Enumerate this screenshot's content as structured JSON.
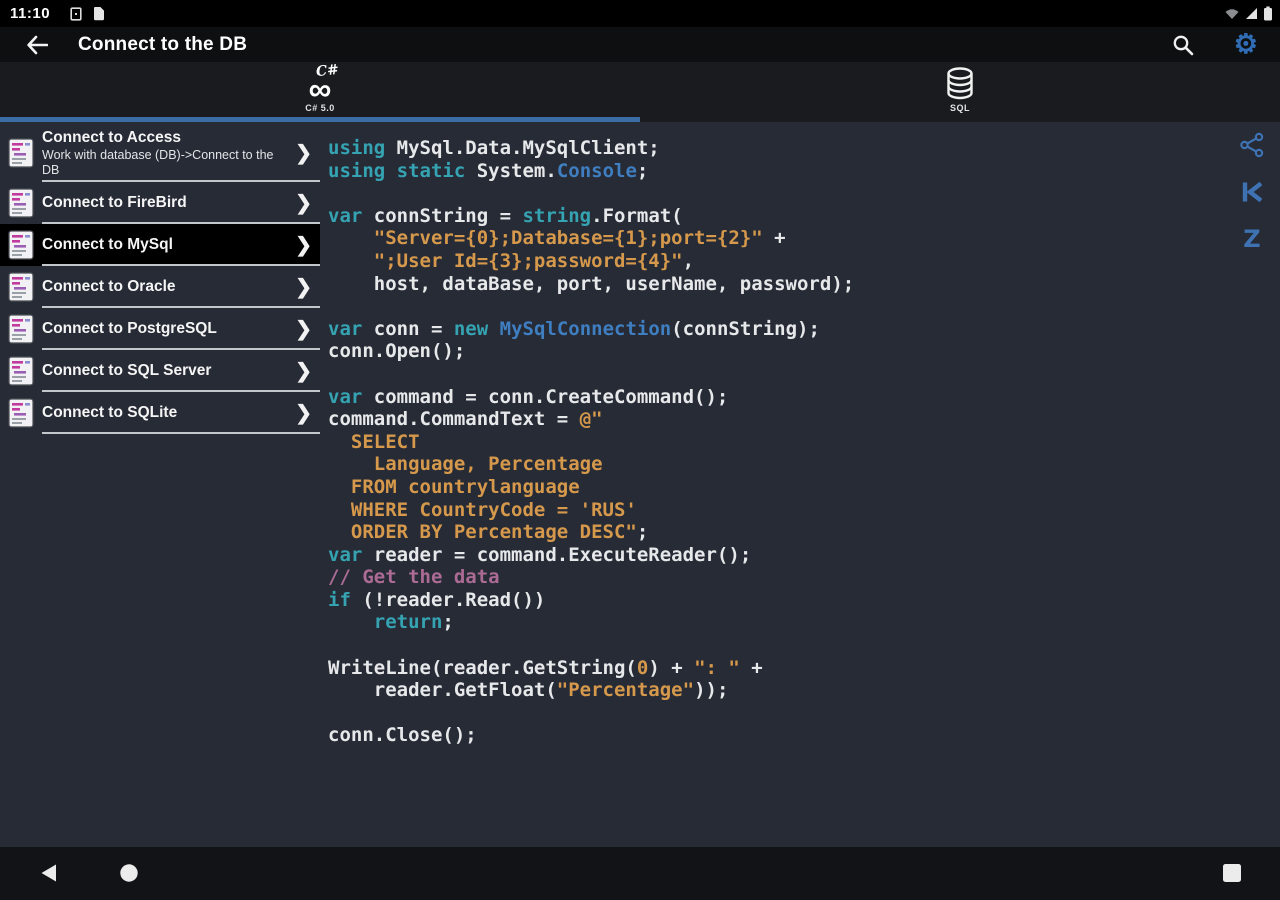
{
  "colors": {
    "bg-content": "#262b36",
    "bg-status": "#000000",
    "bg-appbar": "#0e0f11",
    "bg-tabbar": "#191b1e",
    "bg-navbar": "#121316",
    "accent": "#3b6ca3",
    "icon-blue": "#3e72b2",
    "gear-blue": "#2f6cb3",
    "divider": "#c3c6ca",
    "selected-bg": "#000000",
    "tok-kw": "#35a3b2",
    "tok-cls": "#3f7ec0",
    "tok-str": "#d6994c",
    "tok-com": "#ab6b94",
    "tok-num": "#d6994c",
    "tok-pl": "#e6e8ea"
  },
  "status_bar": {
    "time": "11:10"
  },
  "app_bar": {
    "title": "Connect to the DB"
  },
  "tab_bar": {
    "tabs": [
      {
        "label": "C# 5.0",
        "icon": "csharp-infinity-icon",
        "active": true
      },
      {
        "label": "SQL",
        "icon": "database-icon",
        "active": false
      }
    ]
  },
  "sidebar": {
    "items": [
      {
        "title": "Connect to Access",
        "subtitle": "Work with database (DB)->Connect to the DB",
        "selected": false
      },
      {
        "title": "Connect to FireBird",
        "subtitle": "",
        "selected": false
      },
      {
        "title": "Connect to MySql",
        "subtitle": "",
        "selected": true
      },
      {
        "title": "Connect to Oracle",
        "subtitle": "",
        "selected": false
      },
      {
        "title": "Connect to PostgreSQL",
        "subtitle": "",
        "selected": false
      },
      {
        "title": "Connect to SQL Server",
        "subtitle": "",
        "selected": false
      },
      {
        "title": "Connect to SQLite",
        "subtitle": "",
        "selected": false
      }
    ],
    "chevron_glyph": "❯"
  },
  "code": {
    "language": "C#",
    "lines": [
      [
        [
          "kw",
          "using"
        ],
        [
          "pl",
          " MySql.Data.MySqlClient;"
        ]
      ],
      [
        [
          "kw",
          "using"
        ],
        [
          "pl",
          " "
        ],
        [
          "kw",
          "static"
        ],
        [
          "pl",
          " System."
        ],
        [
          "cls",
          "Console"
        ],
        [
          "pl",
          ";"
        ]
      ],
      [],
      [
        [
          "kw",
          "var"
        ],
        [
          "pl",
          " connString = "
        ],
        [
          "kw",
          "string"
        ],
        [
          "pl",
          ".Format("
        ]
      ],
      [
        [
          "pl",
          "    "
        ],
        [
          "str",
          "\"Server={0};Database={1};port={2}\""
        ],
        [
          "pl",
          " +"
        ]
      ],
      [
        [
          "pl",
          "    "
        ],
        [
          "str",
          "\";User Id={3};password={4}\""
        ],
        [
          "pl",
          ","
        ]
      ],
      [
        [
          "pl",
          "    host, dataBase, port, userName, password);"
        ]
      ],
      [],
      [
        [
          "kw",
          "var"
        ],
        [
          "pl",
          " conn = "
        ],
        [
          "kw",
          "new"
        ],
        [
          "pl",
          " "
        ],
        [
          "cls",
          "MySqlConnection"
        ],
        [
          "pl",
          "(connString);"
        ]
      ],
      [
        [
          "pl",
          "conn.Open();"
        ]
      ],
      [],
      [
        [
          "kw",
          "var"
        ],
        [
          "pl",
          " command = conn.CreateCommand();"
        ]
      ],
      [
        [
          "pl",
          "command.CommandText = "
        ],
        [
          "str",
          "@\""
        ]
      ],
      [
        [
          "str",
          "  SELECT"
        ]
      ],
      [
        [
          "str",
          "    Language, Percentage"
        ]
      ],
      [
        [
          "str",
          "  FROM countrylanguage"
        ]
      ],
      [
        [
          "str",
          "  WHERE CountryCode = 'RUS'"
        ]
      ],
      [
        [
          "str",
          "  ORDER BY Percentage DESC\""
        ],
        [
          "pl",
          ";"
        ]
      ],
      [
        [
          "kw",
          "var"
        ],
        [
          "pl",
          " reader = command.ExecuteReader();"
        ]
      ],
      [
        [
          "com",
          "// Get the data"
        ]
      ],
      [
        [
          "kw",
          "if"
        ],
        [
          "pl",
          " (!reader.Read())"
        ]
      ],
      [
        [
          "pl",
          "    "
        ],
        [
          "kw",
          "return"
        ],
        [
          "pl",
          ";"
        ]
      ],
      [],
      [
        [
          "pl",
          "WriteLine(reader.GetString("
        ],
        [
          "num",
          "0"
        ],
        [
          "pl",
          ") + "
        ],
        [
          "str",
          "\": \""
        ],
        [
          "pl",
          " +"
        ]
      ],
      [
        [
          "pl",
          "    reader.GetFloat("
        ],
        [
          "str",
          "\"Percentage\""
        ],
        [
          "pl",
          "));"
        ]
      ],
      [],
      [
        [
          "pl",
          "conn.Close();"
        ]
      ]
    ]
  },
  "side_actions": [
    {
      "name": "share"
    },
    {
      "name": "skip-back"
    },
    {
      "name": "zoom-z"
    }
  ],
  "nav_bar": {
    "buttons": [
      "back",
      "home",
      "recents"
    ]
  }
}
